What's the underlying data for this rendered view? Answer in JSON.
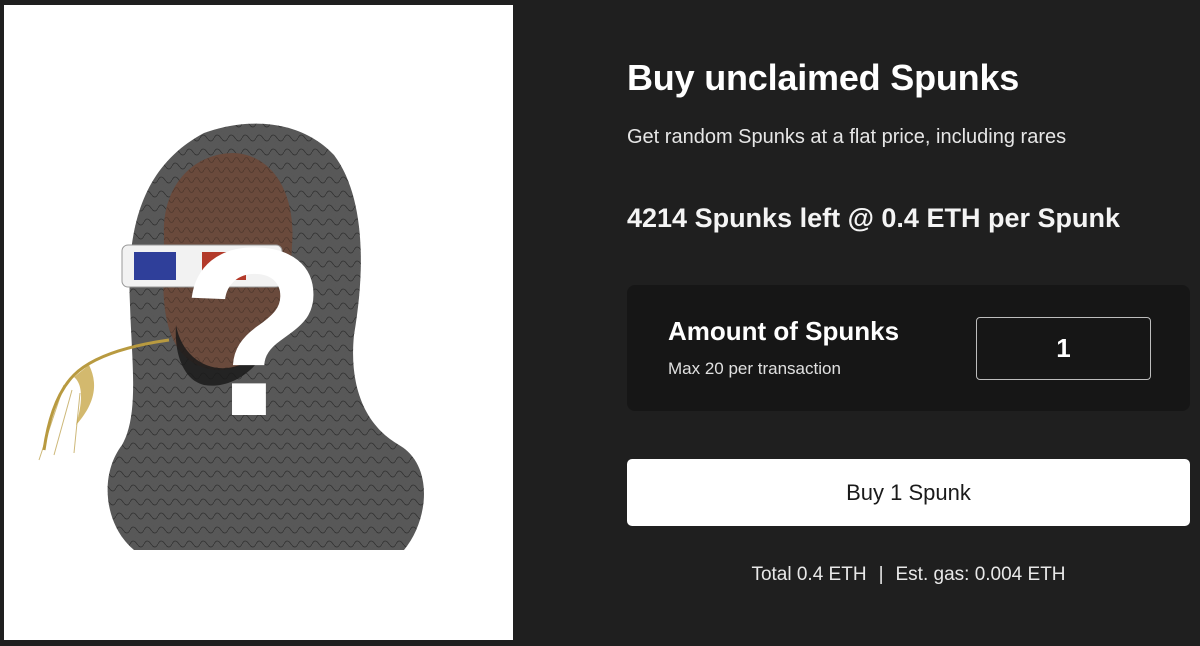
{
  "artwork": {
    "question_mark": "?",
    "colors": {
      "hood": "#3b3b3b",
      "skin": "#6a4a3c",
      "lens_left": "#2f3f9a",
      "lens_right": "#b33a2a",
      "straw": "#b89a40"
    }
  },
  "heading": {
    "title": "Buy unclaimed Spunks",
    "subtitle": "Get random Spunks at a flat price, including rares"
  },
  "stock": {
    "text": "4214 Spunks left @ 0.4 ETH per Spunk"
  },
  "amount": {
    "title": "Amount of Spunks",
    "limit_text": "Max 20 per transaction",
    "value": "1"
  },
  "buy_button": {
    "label": "Buy 1 Spunk"
  },
  "summary": {
    "total": "Total 0.4 ETH",
    "separator": "|",
    "gas": "Est. gas: 0.004 ETH"
  },
  "theme": {
    "background": "#1f1f1f",
    "card": "#161616",
    "button": "#ffffff"
  }
}
